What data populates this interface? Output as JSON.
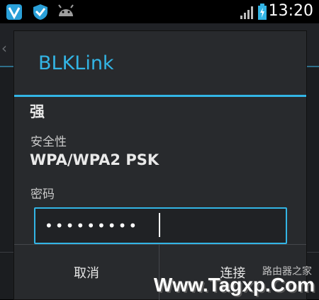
{
  "status_bar": {
    "time": "13:20",
    "icons": [
      "shield-icon",
      "shield-check-icon",
      "android-icon",
      "signal-icon",
      "battery-charging-icon"
    ]
  },
  "dialog": {
    "title": "BLKLink",
    "signal_strength": "强",
    "security_label": "安全性",
    "security_value": "WPA/WPA2 PSK",
    "password_label": "密码",
    "password_value": "•••••••••",
    "cancel_label": "取消",
    "connect_label": "连接"
  },
  "watermark": {
    "text": "Www.Tagxp.Com",
    "cn_text": "路由器之家"
  },
  "colors": {
    "accent": "#33b5e5",
    "dialog_bg": "#282a2d"
  }
}
